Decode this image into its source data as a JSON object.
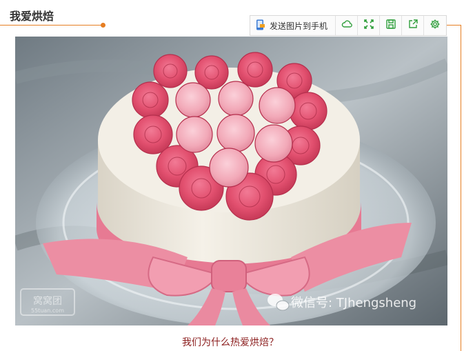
{
  "section": {
    "title": "我爱烘焙"
  },
  "toolbar": {
    "send_label": "发送图片到手机",
    "buttons": [
      {
        "name": "phone-icon"
      },
      {
        "name": "cloud-icon"
      },
      {
        "name": "fullscreen-icon"
      },
      {
        "name": "save-icon"
      },
      {
        "name": "share-icon"
      },
      {
        "name": "gear-icon"
      }
    ]
  },
  "photo": {
    "watermark_left": "窝窝团",
    "watermark_left_sub": "55tuan.com",
    "watermark_right": "微信号: TJhengsheng"
  },
  "caption": {
    "text": "我们为什么热爱烘焙？"
  },
  "colors": {
    "accent": "#e67e22",
    "caption": "#8b1d1d",
    "icon_green": "#2e9e3a"
  }
}
